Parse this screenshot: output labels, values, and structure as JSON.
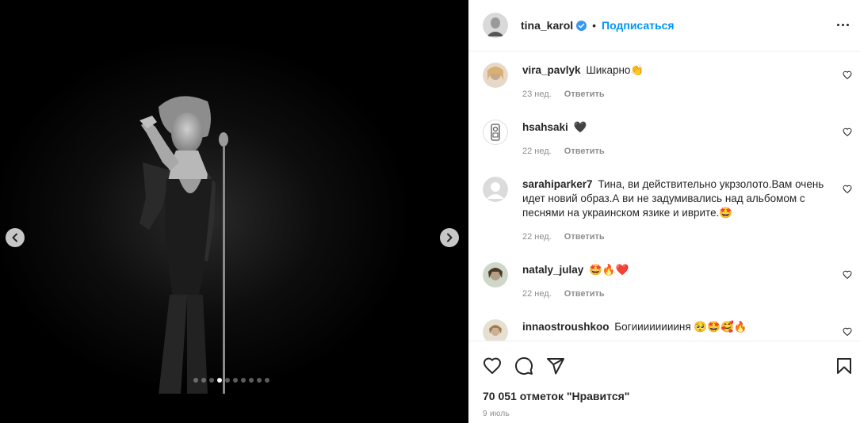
{
  "post": {
    "carousel": {
      "dot_count": 10,
      "active_dot": 3
    }
  },
  "header": {
    "username": "tina_karol",
    "separator": "•",
    "follow_label": "Подписаться"
  },
  "comments": [
    {
      "username": "vira_pavlyk",
      "text": "Шикарно👏",
      "age": "23 нед.",
      "reply_label": "Ответить"
    },
    {
      "username": "hsahsaki",
      "text": "🖤",
      "age": "22 нед.",
      "reply_label": "Ответить"
    },
    {
      "username": "sarahiparker7",
      "text": "Тина, ви действительно укрзолото.Вам очень идет новий образ.А ви не задумивались над альбомом с песнями на украинском язике и иврите.🤩",
      "age": "22 нед.",
      "reply_label": "Ответить"
    },
    {
      "username": "nataly_julay",
      "text": "🤩🔥❤️",
      "age": "22 нед.",
      "reply_label": "Ответить"
    },
    {
      "username": "innaostroushkoo",
      "text": "Богииииииииня 🥺🤩🥰🔥",
      "age": "",
      "reply_label": ""
    }
  ],
  "footer": {
    "likes_text": "70 051 отметок \"Нравится\"",
    "date_text": "9 июль"
  },
  "colors": {
    "accent": "#0095f6",
    "text": "#262626",
    "muted": "#8e8e8e",
    "border": "#efefef"
  },
  "icons": {
    "like": "heart-icon",
    "comment": "comment-bubble-icon",
    "share": "paper-plane-icon",
    "save": "bookmark-icon",
    "more": "more-options-icon",
    "prev": "chevron-left-icon",
    "next": "chevron-right-icon"
  }
}
